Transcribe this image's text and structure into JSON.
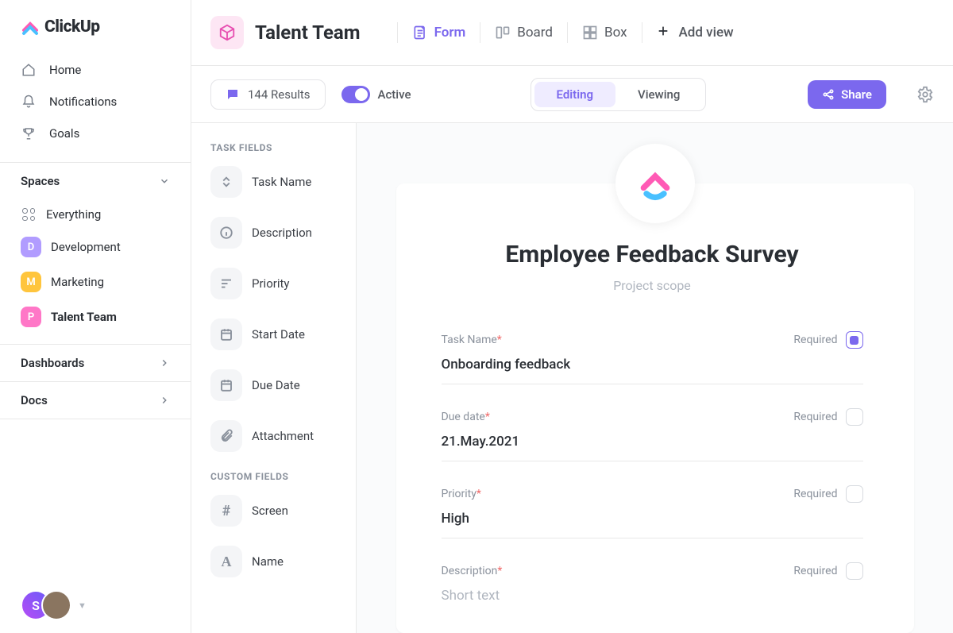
{
  "brand": {
    "name": "ClickUp"
  },
  "nav": {
    "home": "Home",
    "notifications": "Notifications",
    "goals": "Goals"
  },
  "spaces": {
    "heading": "Spaces",
    "everything": "Everything",
    "items": [
      {
        "label": "Development",
        "initial": "D",
        "color": "#b19cff"
      },
      {
        "label": "Marketing",
        "initial": "M",
        "color": "#ffc53d"
      },
      {
        "label": "Talent Team",
        "initial": "P",
        "color": "#ff77c7"
      }
    ],
    "dashboards": "Dashboards",
    "docs": "Docs"
  },
  "avatar": {
    "initial": "S"
  },
  "header": {
    "space_title": "Talent Team",
    "views": {
      "form": "Form",
      "board": "Board",
      "box": "Box",
      "add": "Add view"
    }
  },
  "toolbar": {
    "results": "144 Results",
    "active": "Active",
    "editing": "Editing",
    "viewing": "Viewing",
    "share": "Share"
  },
  "fields_panel": {
    "task_heading": "TASK FIELDS",
    "task_fields": [
      "Task Name",
      "Description",
      "Priority",
      "Start Date",
      "Due Date",
      "Attachment"
    ],
    "custom_heading": "CUSTOM FIELDS",
    "custom_fields": [
      "Screen",
      "Name"
    ]
  },
  "form": {
    "title": "Employee Feedback Survey",
    "subtitle": "Project scope",
    "required_label": "Required",
    "fields": [
      {
        "label": "Task Name",
        "value": "Onboarding feedback",
        "required_checked": true
      },
      {
        "label": "Due date",
        "value": "21.May.2021",
        "required_checked": false
      },
      {
        "label": "Priority",
        "value": "High",
        "required_checked": false
      },
      {
        "label": "Description",
        "value": "Short text",
        "required_checked": false,
        "placeholder": true
      }
    ]
  }
}
